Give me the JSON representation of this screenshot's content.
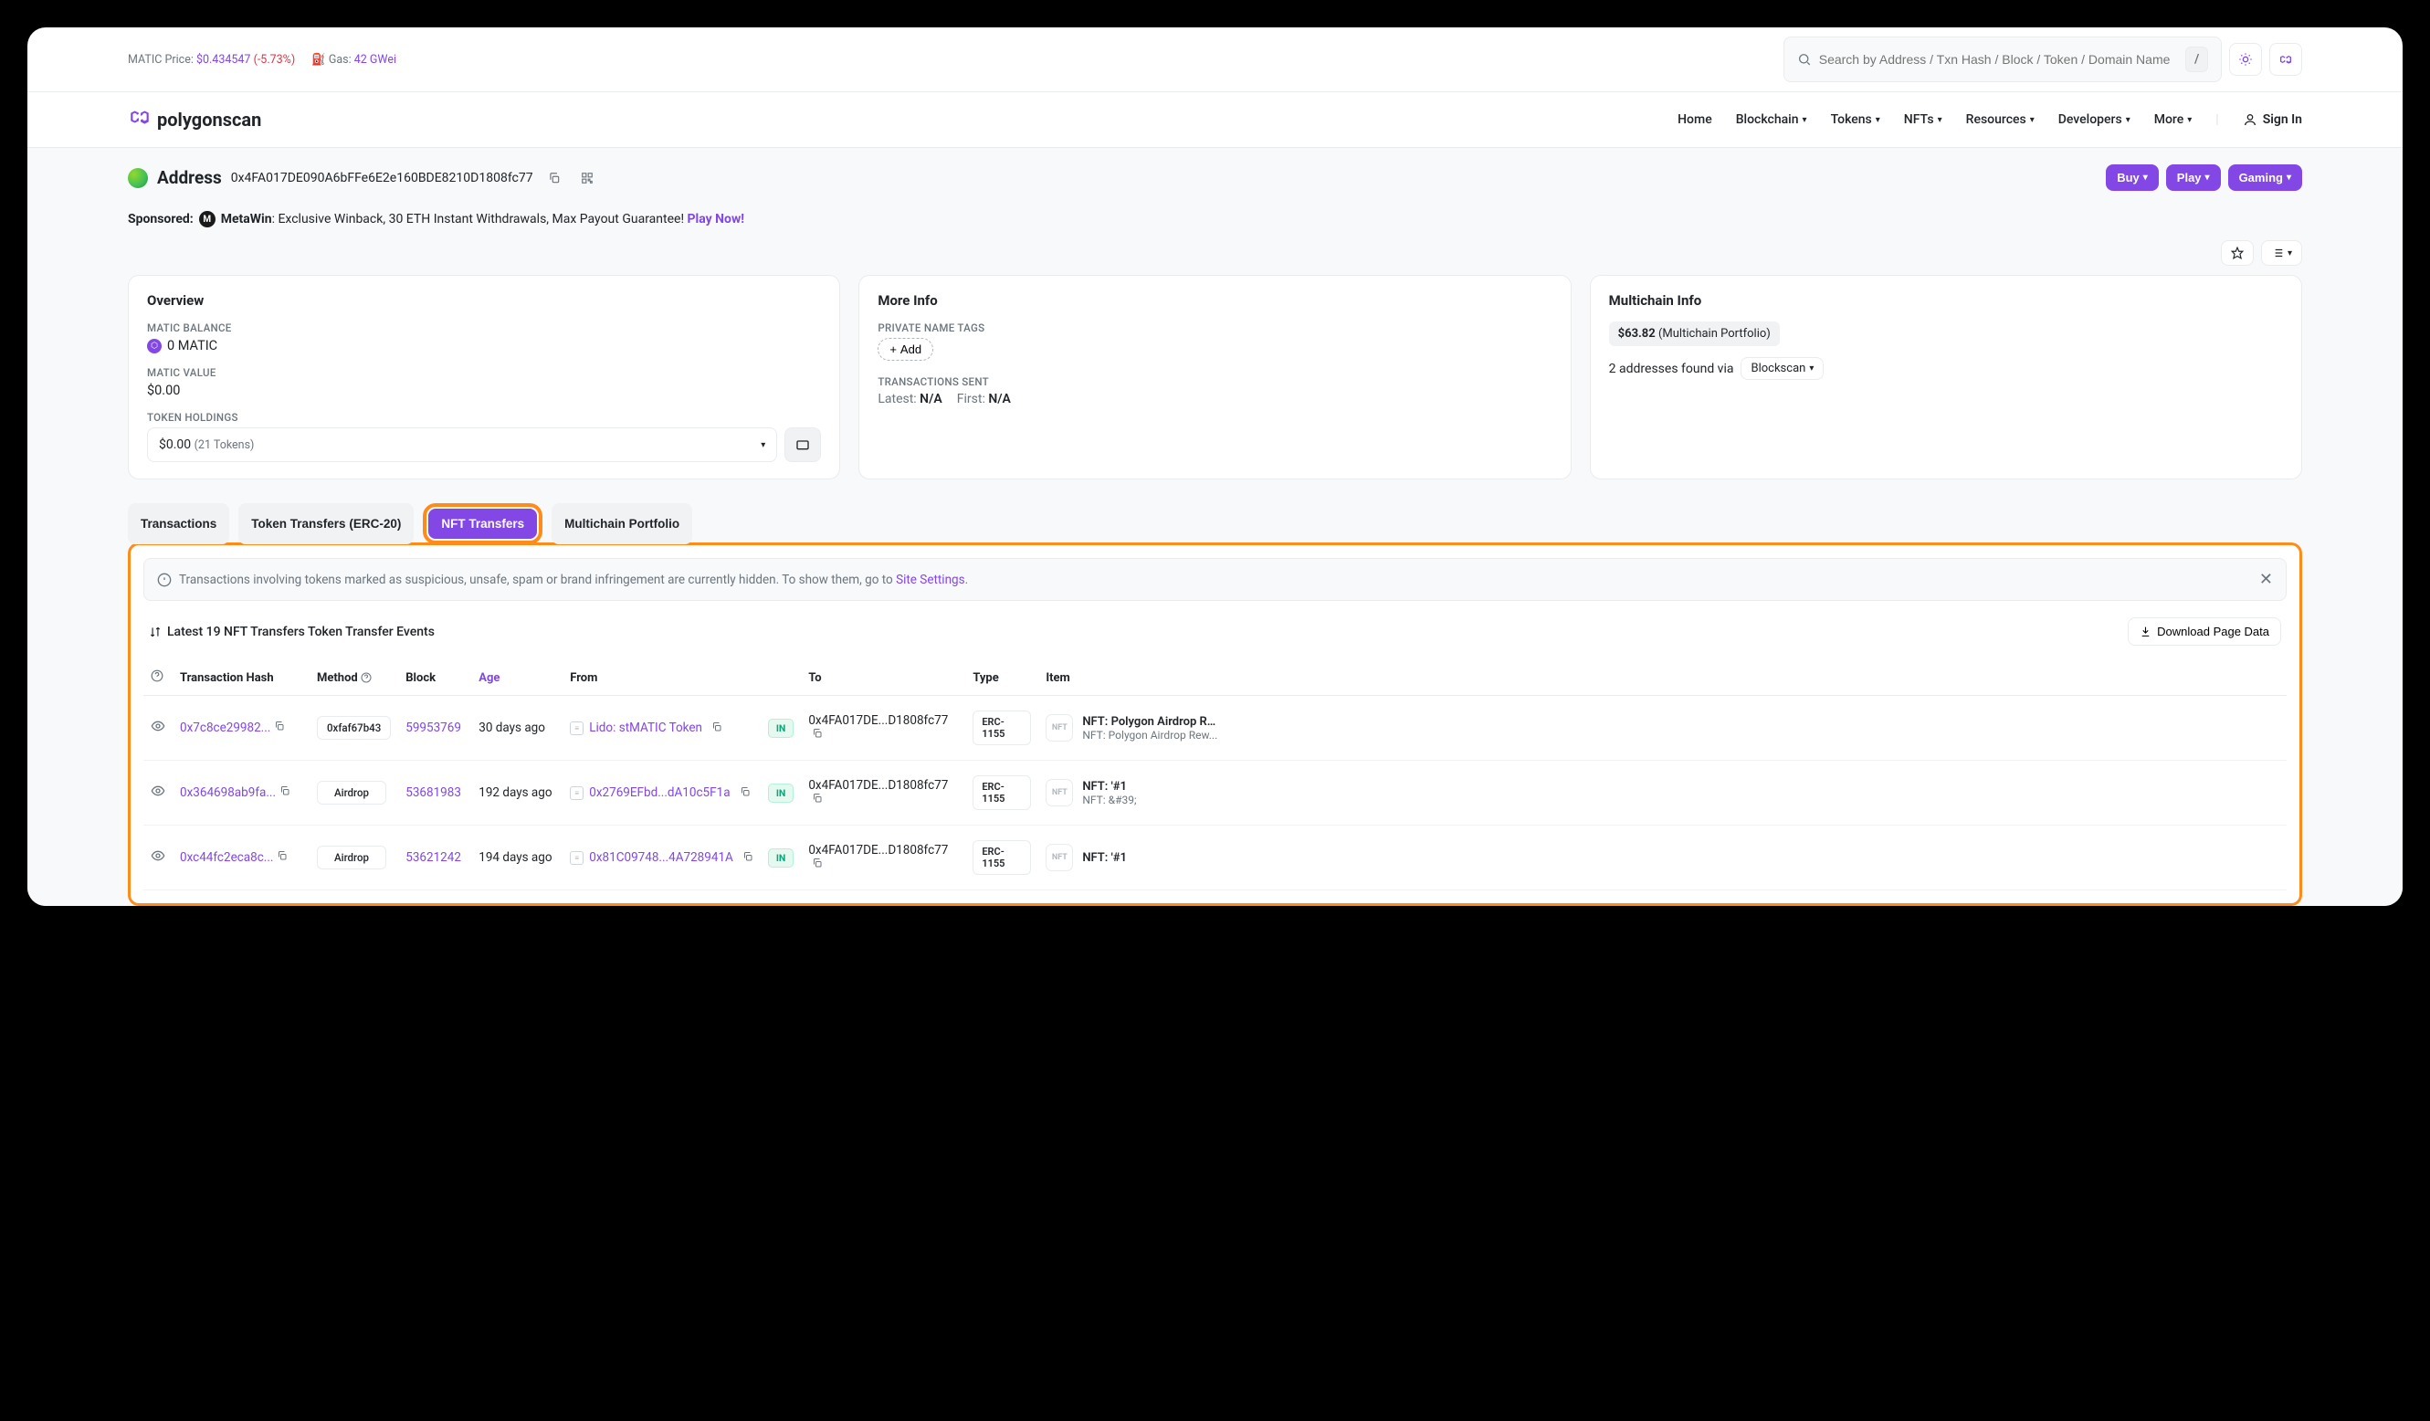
{
  "topbar": {
    "price_label": "MATIC Price: ",
    "price": "$0.434547",
    "price_change": "(-5.73%)",
    "gas_label": "Gas: ",
    "gas": "42 GWei",
    "search_placeholder": "Search by Address / Txn Hash / Block / Token / Domain Name",
    "slash": "/"
  },
  "nav": {
    "brand": "polygonscan",
    "items": [
      "Home",
      "Blockchain",
      "Tokens",
      "NFTs",
      "Resources",
      "Developers",
      "More"
    ],
    "signin": "Sign In"
  },
  "address": {
    "title": "Address",
    "hash": "0x4FA017DE090A6bFFe6E2e160BDE8210D1808fc77",
    "buttons": {
      "buy": "Buy",
      "play": "Play",
      "gaming": "Gaming"
    }
  },
  "sponsored": {
    "label": "Sponsored:",
    "brand": "MetaWin",
    "text": ": Exclusive Winback, 30 ETH Instant Withdrawals, Max Payout Guarantee! ",
    "cta": "Play Now!"
  },
  "overview": {
    "title": "Overview",
    "bal_label": "MATIC BALANCE",
    "bal": "0 MATIC",
    "val_label": "MATIC VALUE",
    "val": "$0.00",
    "hold_label": "TOKEN HOLDINGS",
    "hold_amount": "$0.00",
    "hold_count": "(21 Tokens)"
  },
  "moreinfo": {
    "title": "More Info",
    "tags_label": "PRIVATE NAME TAGS",
    "add": "Add",
    "tx_label": "TRANSACTIONS SENT",
    "latest_l": "Latest:",
    "latest_v": "N/A",
    "first_l": "First:",
    "first_v": "N/A"
  },
  "multichain": {
    "title": "Multichain Info",
    "chip_b": "$63.82",
    "chip_t": "(Multichain Portfolio)",
    "found": "2 addresses found via",
    "blockscan": "Blockscan"
  },
  "tabs": {
    "tx": "Transactions",
    "tt": "Token Transfers (ERC-20)",
    "nft": "NFT Transfers",
    "mp": "Multichain Portfolio"
  },
  "notice": {
    "text": "Transactions involving tokens marked as suspicious, unsafe, spam or brand infringement are currently hidden. To show them, go to ",
    "link": "Site Settings",
    "after": "."
  },
  "table": {
    "title": "Latest 19 NFT Transfers Token Transfer Events",
    "download": "Download Page Data",
    "cols": {
      "hash": "Transaction Hash",
      "method": "Method",
      "block": "Block",
      "age": "Age",
      "from": "From",
      "to": "To",
      "type": "Type",
      "item": "Item"
    },
    "rows": [
      {
        "hash": "0x7c8ce29982...",
        "method": "0xfaf67b43",
        "block": "59953769",
        "age": "30 days ago",
        "from": "Lido: stMATIC Token",
        "from_link": true,
        "to": "0x4FA017DE...D1808fc77",
        "type": "ERC-1155",
        "item_t": "NFT: Polygon Airdrop Re...",
        "item_s": "NFT: Polygon Airdrop Rew..."
      },
      {
        "hash": "0x364698ab9fa...",
        "method": "Airdrop",
        "block": "53681983",
        "age": "192 days ago",
        "from": "0x2769EFbd...dA10c5F1a",
        "from_link": true,
        "to": "0x4FA017DE...D1808fc77",
        "type": "ERC-1155",
        "item_t": "NFT: &#39;#1",
        "item_s": "NFT: &amp;#39;"
      },
      {
        "hash": "0xc44fc2eca8c...",
        "method": "Airdrop",
        "block": "53621242",
        "age": "194 days ago",
        "from": "0x81C09748...4A728941A",
        "from_link": true,
        "to": "0x4FA017DE...D1808fc77",
        "type": "ERC-1155",
        "item_t": "NFT: &#39;#1",
        "item_s": ""
      }
    ]
  }
}
